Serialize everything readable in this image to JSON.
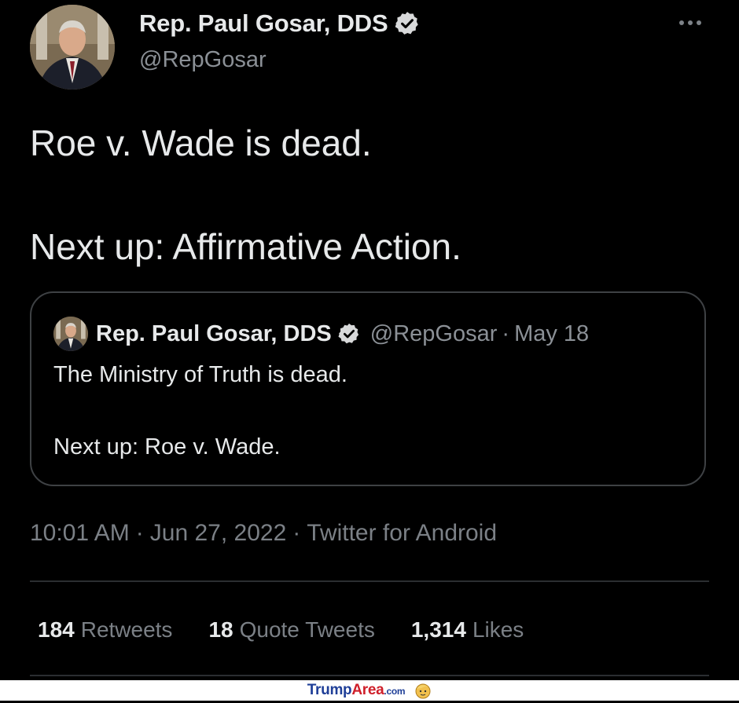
{
  "tweet": {
    "author_name": "Rep. Paul Gosar, DDS",
    "handle": "@RepGosar",
    "text_line1": "Roe v. Wade is dead.",
    "text_line2": "Next up: Affirmative Action.",
    "time": "10:01 AM",
    "date": "Jun 27, 2022",
    "source": "Twitter for Android",
    "meta_separator": "·"
  },
  "quoted": {
    "author_name": "Rep. Paul Gosar, DDS",
    "handle": "@RepGosar",
    "separator": "·",
    "date": "May 18",
    "text_line1": "The Ministry of Truth is dead.",
    "text_line2": "Next up: Roe v. Wade."
  },
  "stats": {
    "retweets_count": "184",
    "retweets_label": "Retweets",
    "quotes_count": "18",
    "quotes_label": "Quote Tweets",
    "likes_count": "1,314",
    "likes_label": "Likes"
  },
  "watermark": {
    "brand_part1": "Trump",
    "brand_part2": "Area",
    "brand_part3": ".com"
  },
  "icons": {
    "verified": "verified-badge-icon",
    "more": "more-options-icon"
  },
  "colors": {
    "background": "#000000",
    "text": "#e7e9ea",
    "secondary": "#8b9096",
    "border": "#3e4144"
  }
}
